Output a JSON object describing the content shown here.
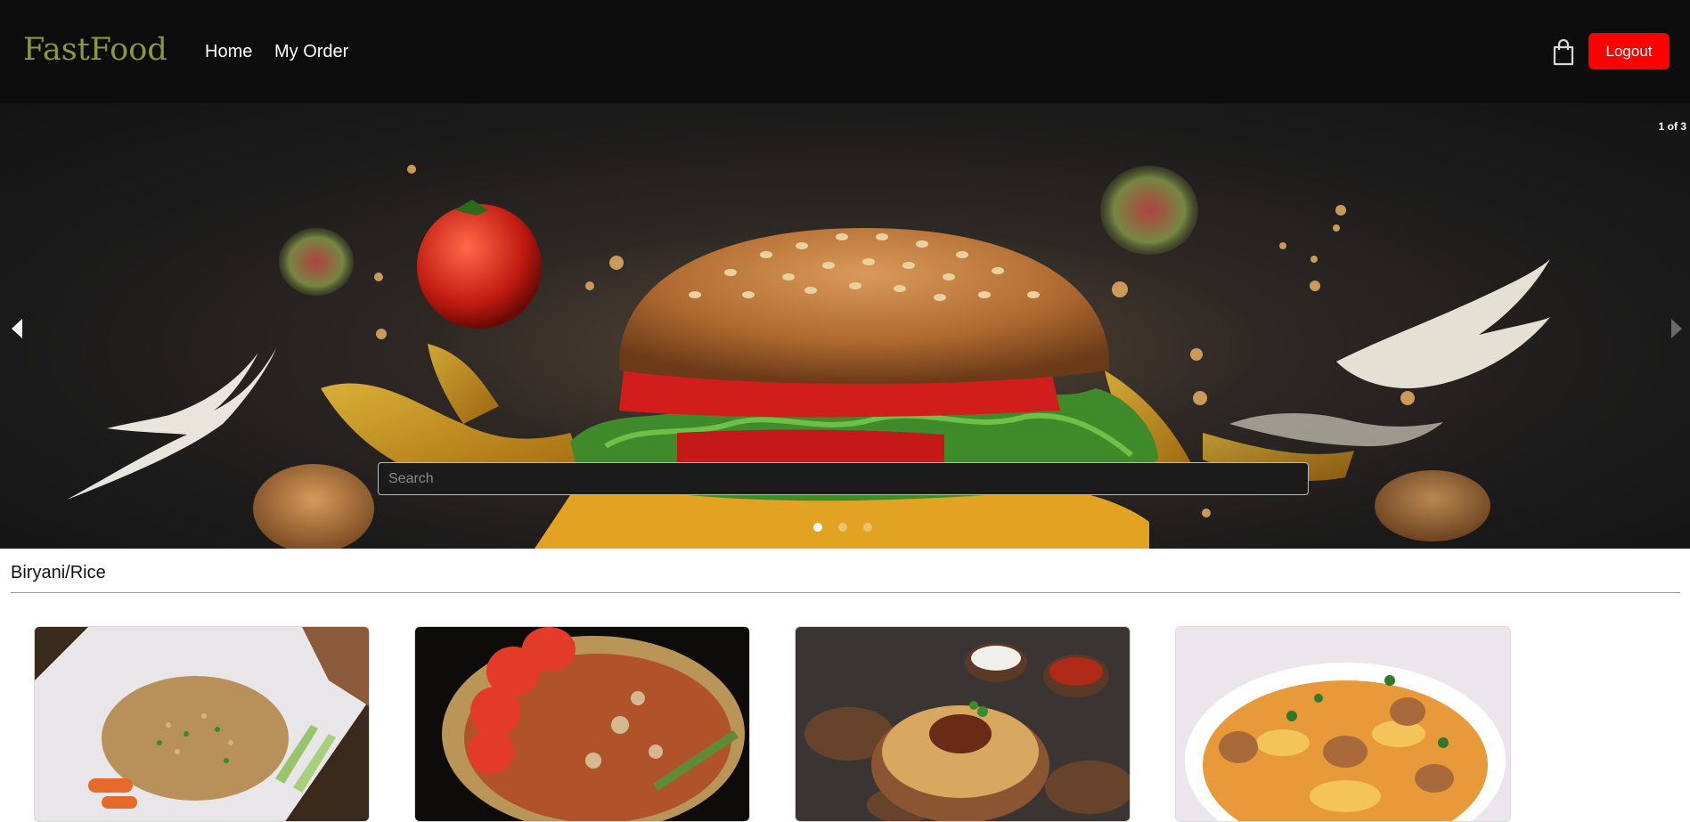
{
  "navbar": {
    "brand": "FastFood",
    "links": [
      {
        "label": "Home"
      },
      {
        "label": "My Order"
      }
    ],
    "cart_icon": "shopping-bag-icon",
    "logout_label": "Logout"
  },
  "carousel": {
    "counter": "1 of 3",
    "search_placeholder": "Search",
    "slides_total": 3,
    "active_slide": 1,
    "prev_icon": "caret-left-icon",
    "next_icon": "caret-right-icon"
  },
  "category": {
    "title": "Biryani/Rice",
    "items": [
      {
        "image": "fried-rice-plate"
      },
      {
        "image": "tomato-rice-bowl"
      },
      {
        "image": "biryani-copper-bowl"
      },
      {
        "image": "chicken-biryani-plate"
      }
    ]
  },
  "colors": {
    "navbar_bg": "#0d0d0d",
    "brand": "#8a9a3b",
    "logout_bg": "#ff0000"
  }
}
